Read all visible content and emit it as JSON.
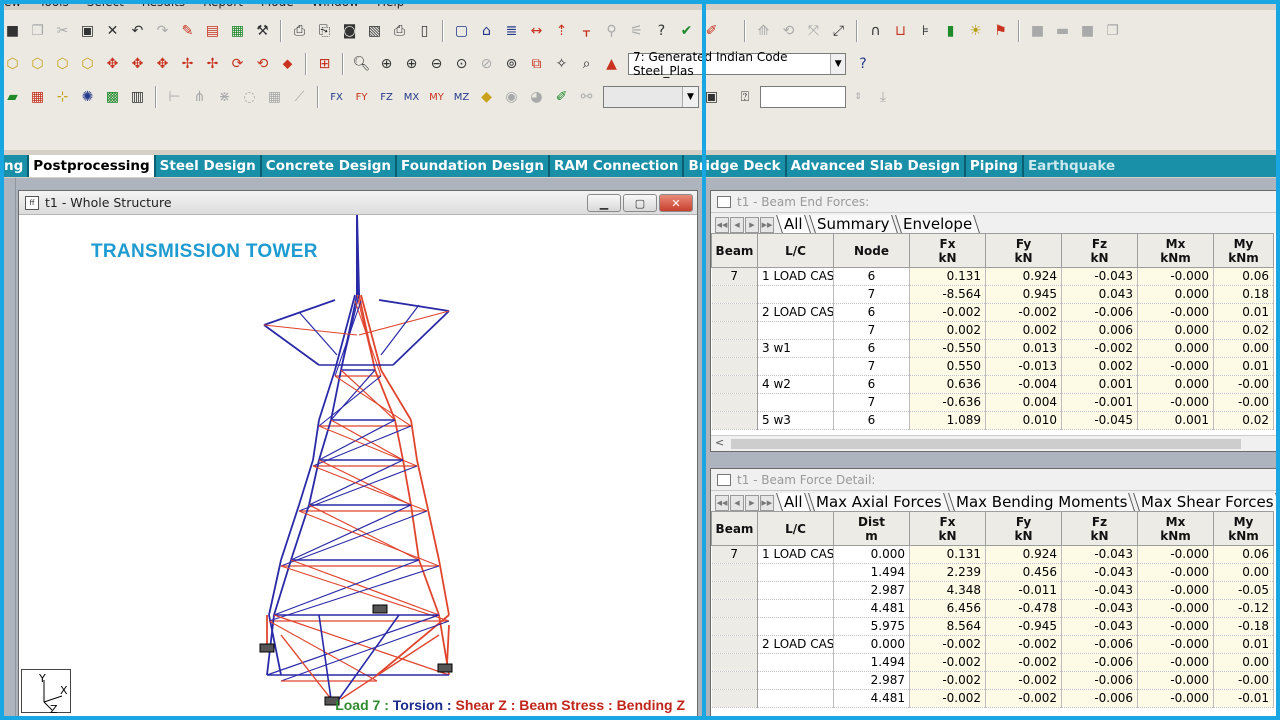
{
  "menu": [
    "ew",
    "Tools",
    "Select",
    "Results",
    "Report",
    "Mode",
    "Window",
    "Help"
  ],
  "toolbar": {
    "load_combo": "7: Generated Indian Code Steel_Plas",
    "empty_combo": "",
    "spin_value": ""
  },
  "mode_tabs": [
    {
      "label": "ng",
      "active": false
    },
    {
      "label": "Postprocessing",
      "active": true
    },
    {
      "label": "Steel Design",
      "active": false
    },
    {
      "label": "Concrete Design",
      "active": false
    },
    {
      "label": "Foundation Design",
      "active": false
    },
    {
      "label": "RAM Connection",
      "active": false
    },
    {
      "label": "Bridge Deck",
      "active": false
    },
    {
      "label": "Advanced Slab Design",
      "active": false
    },
    {
      "label": "Piping",
      "active": false
    },
    {
      "label": "Earthquake",
      "active": false
    }
  ],
  "viewport": {
    "window_title": "t1 - Whole Structure",
    "overlay_title": "TRANSMISSION TOWER",
    "status": {
      "load": "Load 7 :",
      "torsion": "Torsion :",
      "shear": "Shear Z :",
      "stress": "Beam Stress :",
      "bending": "Bending Z"
    },
    "axis": {
      "y": "Y",
      "x": "X",
      "z": "Z"
    }
  },
  "beam_end_forces": {
    "title": "t1 - Beam End Forces:",
    "tabs": [
      "All",
      "Summary",
      "Envelope"
    ],
    "columns": [
      "Beam",
      "L/C",
      "Node",
      "Fx\nkN",
      "Fy\nkN",
      "Fz\nkN",
      "Mx\nkNm",
      "My\nkNm"
    ],
    "rows": [
      [
        "7",
        "1 LOAD CAS",
        "6",
        "0.131",
        "0.924",
        "-0.043",
        "-0.000",
        "0.06"
      ],
      [
        "",
        "",
        "7",
        "-8.564",
        "0.945",
        "0.043",
        "0.000",
        "0.18"
      ],
      [
        "",
        "2 LOAD CAS",
        "6",
        "-0.002",
        "-0.002",
        "-0.006",
        "-0.000",
        "0.01"
      ],
      [
        "",
        "",
        "7",
        "0.002",
        "0.002",
        "0.006",
        "0.000",
        "0.02"
      ],
      [
        "",
        "3 w1",
        "6",
        "-0.550",
        "0.013",
        "-0.002",
        "0.000",
        "0.00"
      ],
      [
        "",
        "",
        "7",
        "0.550",
        "-0.013",
        "0.002",
        "-0.000",
        "0.01"
      ],
      [
        "",
        "4 w2",
        "6",
        "0.636",
        "-0.004",
        "0.001",
        "0.000",
        "-0.00"
      ],
      [
        "",
        "",
        "7",
        "-0.636",
        "0.004",
        "-0.001",
        "-0.000",
        "-0.00"
      ],
      [
        "",
        "5 w3",
        "6",
        "1.089",
        "0.010",
        "-0.045",
        "0.001",
        "0.02"
      ]
    ]
  },
  "beam_force_detail": {
    "title": "t1 - Beam Force Detail:",
    "tabs": [
      "All",
      "Max Axial Forces",
      "Max Bending Moments",
      "Max Shear Forces"
    ],
    "columns": [
      "Beam",
      "L/C",
      "Dist\nm",
      "Fx\nkN",
      "Fy\nkN",
      "Fz\nkN",
      "Mx\nkNm",
      "My\nkNm"
    ],
    "rows": [
      [
        "7",
        "1 LOAD CAS",
        "0.000",
        "0.131",
        "0.924",
        "-0.043",
        "-0.000",
        "0.06"
      ],
      [
        "",
        "",
        "1.494",
        "2.239",
        "0.456",
        "-0.043",
        "-0.000",
        "0.00"
      ],
      [
        "",
        "",
        "2.987",
        "4.348",
        "-0.011",
        "-0.043",
        "-0.000",
        "-0.05"
      ],
      [
        "",
        "",
        "4.481",
        "6.456",
        "-0.478",
        "-0.043",
        "-0.000",
        "-0.12"
      ],
      [
        "",
        "",
        "5.975",
        "8.564",
        "-0.945",
        "-0.043",
        "-0.000",
        "-0.18"
      ],
      [
        "",
        "2 LOAD CAS",
        "0.000",
        "-0.002",
        "-0.002",
        "-0.006",
        "-0.000",
        "0.01"
      ],
      [
        "",
        "",
        "1.494",
        "-0.002",
        "-0.002",
        "-0.006",
        "-0.000",
        "0.00"
      ],
      [
        "",
        "",
        "2.987",
        "-0.002",
        "-0.002",
        "-0.006",
        "-0.000",
        "-0.00"
      ],
      [
        "",
        "",
        "4.481",
        "-0.002",
        "-0.002",
        "-0.006",
        "-0.000",
        "-0.01"
      ]
    ]
  },
  "colors": {
    "accent": "#18a7e3",
    "mode_bar": "#1a8fa8",
    "tower_blue": "#2a2aa8",
    "tower_red": "#e0452e"
  }
}
